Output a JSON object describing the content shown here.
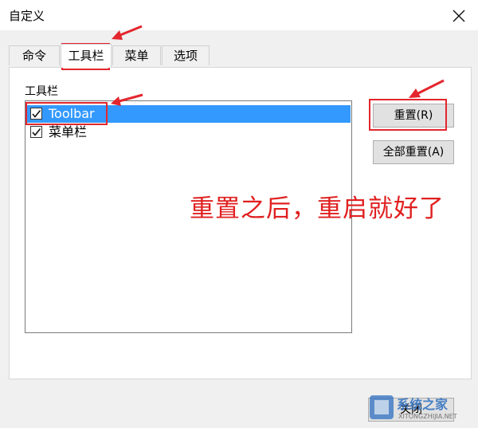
{
  "window": {
    "title": "自定义"
  },
  "tabs": [
    {
      "label": "命令"
    },
    {
      "label": "工具栏"
    },
    {
      "label": "菜单"
    },
    {
      "label": "选项"
    }
  ],
  "toolbar_group": {
    "label": "工具栏",
    "items": [
      {
        "label": "Toolbar",
        "checked": true,
        "selected": true
      },
      {
        "label": "菜单栏",
        "checked": true,
        "selected": false
      }
    ]
  },
  "buttons": {
    "reset": "重置(R)",
    "reset_all": "全部重置(A)",
    "close": "关闭"
  },
  "annotation": {
    "text": "重置之后，重启就好了"
  },
  "watermark": {
    "brand": "系统之家",
    "url": "XITONGZHIJIA.NET"
  },
  "colors": {
    "accent": "#3399ff",
    "highlight": "#e3262d"
  }
}
